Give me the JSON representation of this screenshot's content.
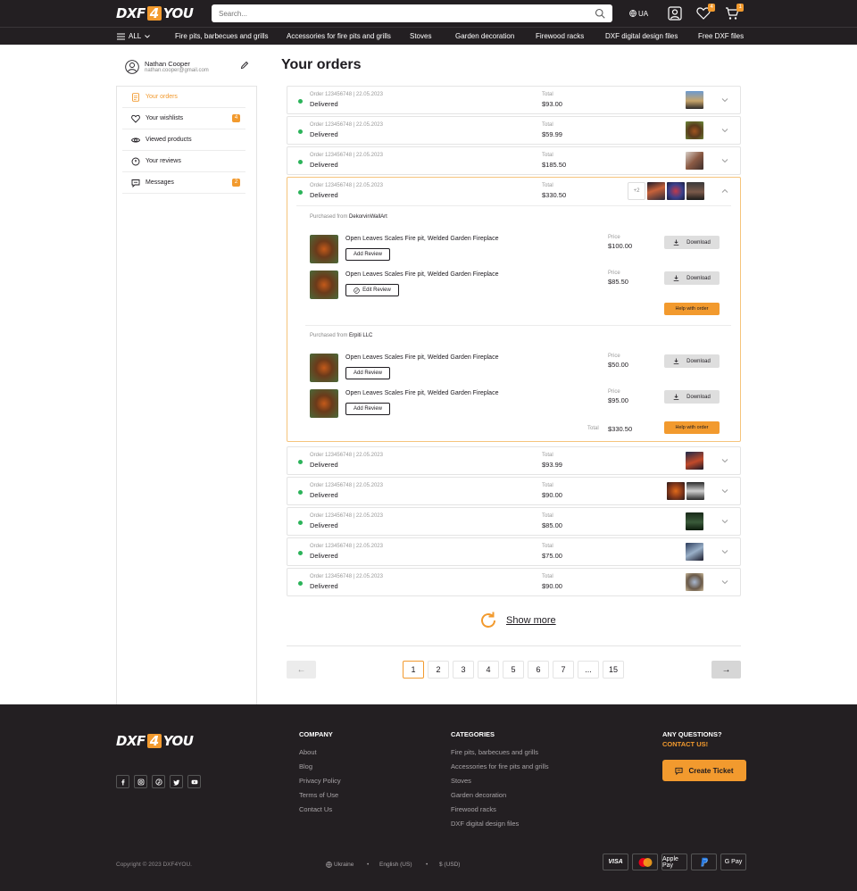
{
  "header": {
    "logo_left": "DXF",
    "logo_num": "4",
    "logo_right": "YOU",
    "search_placeholder": "Search...",
    "lang": "UA",
    "wishlist_count": "4",
    "cart_count": "1"
  },
  "nav": {
    "all_label": "ALL",
    "items": [
      "Fire pits, barbecues and grills",
      "Accessories for fire pits and grills",
      "Stoves",
      "Garden decoration",
      "Firewood racks",
      "DXF digital design files",
      "Free DXF files"
    ]
  },
  "user": {
    "name": "Nathan Cooper",
    "email": "nathan.cooper@gmail.com"
  },
  "sidebar": {
    "items": [
      {
        "label": "Your orders",
        "icon": "orders-icon",
        "badge": ""
      },
      {
        "label": "Your wishlists",
        "icon": "heart-icon",
        "badge": "4"
      },
      {
        "label": "Viewed products",
        "icon": "eye-icon",
        "badge": ""
      },
      {
        "label": "Your reviews",
        "icon": "review-icon",
        "badge": ""
      },
      {
        "label": "Messages",
        "icon": "message-icon",
        "badge": "2"
      }
    ]
  },
  "page_title": "Your orders",
  "orders": [
    {
      "number": "Order 123456748 | 22.05.2023",
      "status": "Delivered",
      "total_label": "Total",
      "total": "$93.00"
    },
    {
      "number": "Order 123456748 | 22.05.2023",
      "status": "Delivered",
      "total_label": "Total",
      "total": "$59.99"
    },
    {
      "number": "Order 123456748 | 22.05.2023",
      "status": "Delivered",
      "total_label": "Total",
      "total": "$185.50"
    },
    {
      "number": "Order 123456748 | 22.05.2023",
      "status": "Delivered",
      "total_label": "Total",
      "total": "$330.50",
      "more": "+2"
    },
    {
      "number": "Order 123456748 | 22.05.2023",
      "status": "Delivered",
      "total_label": "Total",
      "total": "$93.99"
    },
    {
      "number": "Order 123456748 | 22.05.2023",
      "status": "Delivered",
      "total_label": "Total",
      "total": "$90.00"
    },
    {
      "number": "Order 123456748 | 22.05.2023",
      "status": "Delivered",
      "total_label": "Total",
      "total": "$85.00"
    },
    {
      "number": "Order 123456748 | 22.05.2023",
      "status": "Delivered",
      "total_label": "Total",
      "total": "$75.00"
    },
    {
      "number": "Order 123456748 | 22.05.2023",
      "status": "Delivered",
      "total_label": "Total",
      "total": "$90.00"
    }
  ],
  "expanded": {
    "purchased_from": "Purchased from",
    "sellers": [
      {
        "name": "DekorvinWallArt",
        "items": [
          {
            "name": "Open Leaves Scales Fire pit, Welded Garden Fireplace",
            "review": "Add Review",
            "price_label": "Price",
            "price": "$100.00",
            "download": "Download"
          },
          {
            "name": "Open Leaves Scales Fire pit, Welded Garden Fireplace",
            "review": "Edit Review",
            "price_label": "Price",
            "price": "$85.50",
            "download": "Download"
          }
        ],
        "help": "Help with order"
      },
      {
        "name": "Erpiti LLC",
        "items": [
          {
            "name": "Open Leaves Scales Fire pit, Welded Garden Fireplace",
            "review": "Add Review",
            "price_label": "Price",
            "price": "$50.00",
            "download": "Download"
          },
          {
            "name": "Open Leaves Scales Fire pit, Welded Garden Fireplace",
            "review": "Add Review",
            "price_label": "Price",
            "price": "$95.00",
            "download": "Download"
          }
        ],
        "help": "Help with order"
      }
    ],
    "total_label": "Total",
    "total": "$330.50"
  },
  "show_more": "Show more",
  "pagination": {
    "prev": "←",
    "next": "→",
    "pages": [
      "1",
      "2",
      "3",
      "4",
      "5",
      "6",
      "7",
      "...",
      "15"
    ],
    "current": "1"
  },
  "footer": {
    "company_title": "COMPANY",
    "company_links": [
      "About",
      "Blog",
      "Privacy Policy",
      "Terms of Use",
      "Contact Us"
    ],
    "categories_title": "CATEGORIES",
    "category_links": [
      "Fire pits, barbecues and grills",
      "Accessories for fire pits and grills",
      "Stoves",
      "Garden decoration",
      "Firewood racks",
      "DXF digital design files"
    ],
    "questions": "ANY QUESTIONS?",
    "contact": "CONTACT US!",
    "ticket": "Create Ticket",
    "copyright": "Copyright © 2023 DXF4YOU.",
    "country": "Ukraine",
    "language": "English (US)",
    "currency": "$ (USD)",
    "payments": [
      "VISA",
      "Apple Pay",
      "G Pay"
    ]
  },
  "colors": {
    "accent": "#f29a2e",
    "dark": "#231f22",
    "status": "#2bb359"
  }
}
